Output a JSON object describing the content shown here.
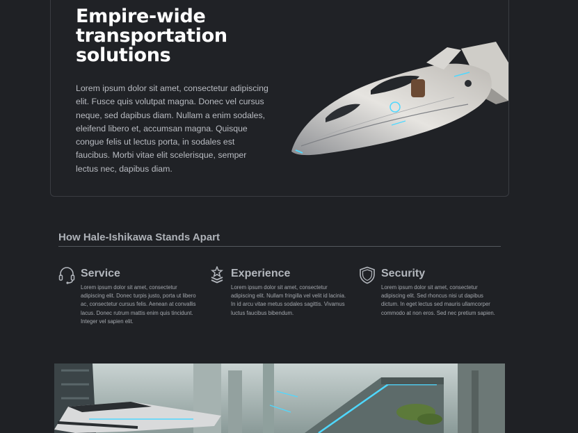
{
  "hero": {
    "title": "Empire-wide transportation solutions",
    "body": "Lorem ipsum dolor sit amet, consectetur adipiscing elit. Fusce quis volutpat magna. Donec vel cursus neque, sed dapibus diam. Nullam a enim sodales, eleifend libero et, accumsan magna. Quisque congue felis ut lectus porta, in sodales est faucibus. Morbi vitae elit scelerisque, semper lectus nec, dapibus diam."
  },
  "section": {
    "heading": "How Hale-Ishikawa Stands Apart"
  },
  "features": [
    {
      "icon": "headset-icon",
      "title": "Service",
      "text": "Lorem ipsum dolor sit amet, consectetur adipiscing elit. Donec turpis justo, porta ut libero ac, consectetur cursus felis. Aenean at convallis lacus. Donec rutrum mattis enim quis tincidunt. Integer vel sapien elit."
    },
    {
      "icon": "medal-icon",
      "title": "Experience",
      "text": "Lorem ipsum dolor sit amet, consectetur adipiscing elit. Nullam fringilla vel velit id lacinia. In id arcu vitae metus sodales sagittis. Vivamus luctus faucibus bibendum."
    },
    {
      "icon": "shield-check-icon",
      "title": "Security",
      "text": "Lorem ipsum dolor sit amet, consectetur adipiscing elit. Sed rhoncus nisi ut dapibus dictum. In eget lectus sed mauris ullamcorper commodo at non eros. Sed nec pretium sapien."
    }
  ],
  "colors": {
    "background": "#1f2125",
    "heading": "#ffffff",
    "body_text": "#b9bcc2",
    "accent_cyan": "#4fd8ff"
  }
}
